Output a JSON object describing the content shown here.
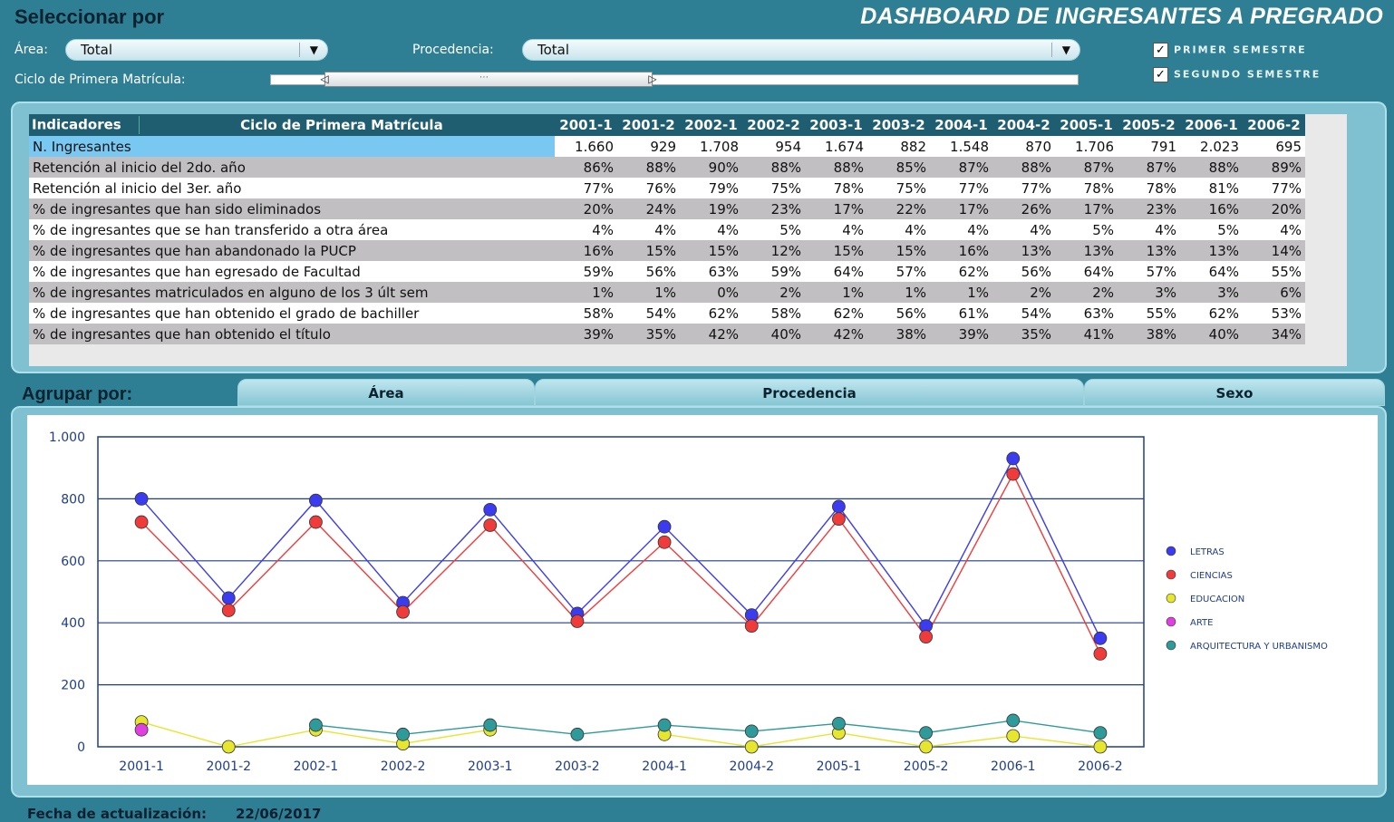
{
  "header": {
    "select_title": "Seleccionar por",
    "dashboard_title": "DASHBOARD DE INGRESANTES A PREGRADO"
  },
  "filters": {
    "area_label": "Área:",
    "area_value": "Total",
    "procedencia_label": "Procedencia:",
    "procedencia_value": "Total",
    "ciclo_label": "Ciclo de Primera Matrícula:",
    "semester_checks": [
      {
        "label": "PRIMER SEMESTRE",
        "checked": true
      },
      {
        "label": "SEGUNDO SEMESTRE",
        "checked": true
      }
    ]
  },
  "table": {
    "header_indicators": "Indicadores",
    "header_ciclo": "Ciclo de Primera Matrícula",
    "columns": [
      "2001-1",
      "2001-2",
      "2002-1",
      "2002-2",
      "2003-1",
      "2003-2",
      "2004-1",
      "2004-2",
      "2005-1",
      "2005-2",
      "2006-1",
      "2006-2"
    ],
    "rows": [
      {
        "label": "N. Ingresantes",
        "values": [
          "1.660",
          "929",
          "1.708",
          "954",
          "1.674",
          "882",
          "1.548",
          "870",
          "1.706",
          "791",
          "2.023",
          "695"
        ]
      },
      {
        "label": "Retención al inicio del 2do. año",
        "values": [
          "86%",
          "88%",
          "90%",
          "88%",
          "88%",
          "85%",
          "87%",
          "88%",
          "87%",
          "87%",
          "88%",
          "89%"
        ]
      },
      {
        "label": "Retención al inicio del 3er. año",
        "values": [
          "77%",
          "76%",
          "79%",
          "75%",
          "78%",
          "75%",
          "77%",
          "77%",
          "78%",
          "78%",
          "81%",
          "77%"
        ]
      },
      {
        "label": "% de ingresantes que han sido eliminados",
        "values": [
          "20%",
          "24%",
          "19%",
          "23%",
          "17%",
          "22%",
          "17%",
          "26%",
          "17%",
          "23%",
          "16%",
          "20%"
        ]
      },
      {
        "label": "% de ingresantes que se han transferido a otra área",
        "values": [
          "4%",
          "4%",
          "4%",
          "5%",
          "4%",
          "4%",
          "4%",
          "4%",
          "5%",
          "4%",
          "5%",
          "4%"
        ]
      },
      {
        "label": "% de ingresantes que han abandonado la PUCP",
        "values": [
          "16%",
          "15%",
          "15%",
          "12%",
          "15%",
          "15%",
          "16%",
          "13%",
          "13%",
          "13%",
          "13%",
          "14%"
        ]
      },
      {
        "label": "% de ingresantes que han egresado de Facultad",
        "values": [
          "59%",
          "56%",
          "63%",
          "59%",
          "64%",
          "57%",
          "62%",
          "56%",
          "64%",
          "57%",
          "64%",
          "55%"
        ]
      },
      {
        "label": "% de ingresantes matriculados en alguno de los 3 últ sem",
        "values": [
          "1%",
          "1%",
          "0%",
          "2%",
          "1%",
          "1%",
          "1%",
          "2%",
          "2%",
          "3%",
          "3%",
          "6%"
        ]
      },
      {
        "label": "% de ingresantes que han obtenido el grado de bachiller",
        "values": [
          "58%",
          "54%",
          "62%",
          "58%",
          "62%",
          "56%",
          "61%",
          "54%",
          "63%",
          "55%",
          "62%",
          "53%"
        ]
      },
      {
        "label": "% de ingresantes que han obtenido el título",
        "values": [
          "39%",
          "35%",
          "42%",
          "40%",
          "42%",
          "38%",
          "39%",
          "35%",
          "41%",
          "38%",
          "40%",
          "34%"
        ]
      }
    ]
  },
  "group": {
    "label": "Agrupar por:",
    "tabs": [
      "Área",
      "Procedencia",
      "Sexo"
    ]
  },
  "chart_data": {
    "type": "line",
    "x": [
      "2001-1",
      "2001-2",
      "2002-1",
      "2002-2",
      "2003-1",
      "2003-2",
      "2004-1",
      "2004-2",
      "2005-1",
      "2005-2",
      "2006-1",
      "2006-2"
    ],
    "ylim": [
      0,
      1000
    ],
    "yticks": [
      0,
      200,
      400,
      600,
      800,
      1000
    ],
    "ytick_labels": [
      "0",
      "200",
      "400",
      "600",
      "800",
      "1.000"
    ],
    "grid": true,
    "legend_position": "right",
    "series": [
      {
        "name": "LETRAS",
        "color": "#3b3bf0",
        "values": [
          800,
          480,
          795,
          465,
          765,
          430,
          710,
          425,
          775,
          390,
          930,
          350
        ]
      },
      {
        "name": "CIENCIAS",
        "color": "#f03b3b",
        "values": [
          725,
          440,
          725,
          435,
          715,
          405,
          660,
          390,
          735,
          355,
          880,
          300
        ]
      },
      {
        "name": "EDUCACION",
        "color": "#e6e62e",
        "values": [
          80,
          0,
          55,
          10,
          55,
          null,
          40,
          0,
          45,
          0,
          35,
          0
        ]
      },
      {
        "name": "ARTE",
        "color": "#e040e0",
        "values": [
          55,
          null,
          null,
          null,
          null,
          null,
          null,
          null,
          null,
          null,
          null,
          null
        ]
      },
      {
        "name": "ARQUITECTURA Y URBANISMO",
        "color": "#2e9a9a",
        "values": [
          null,
          null,
          70,
          40,
          70,
          40,
          70,
          50,
          75,
          45,
          85,
          45
        ]
      }
    ]
  },
  "footer": {
    "label": "Fecha de actualización:",
    "date": "22/06/2017"
  }
}
